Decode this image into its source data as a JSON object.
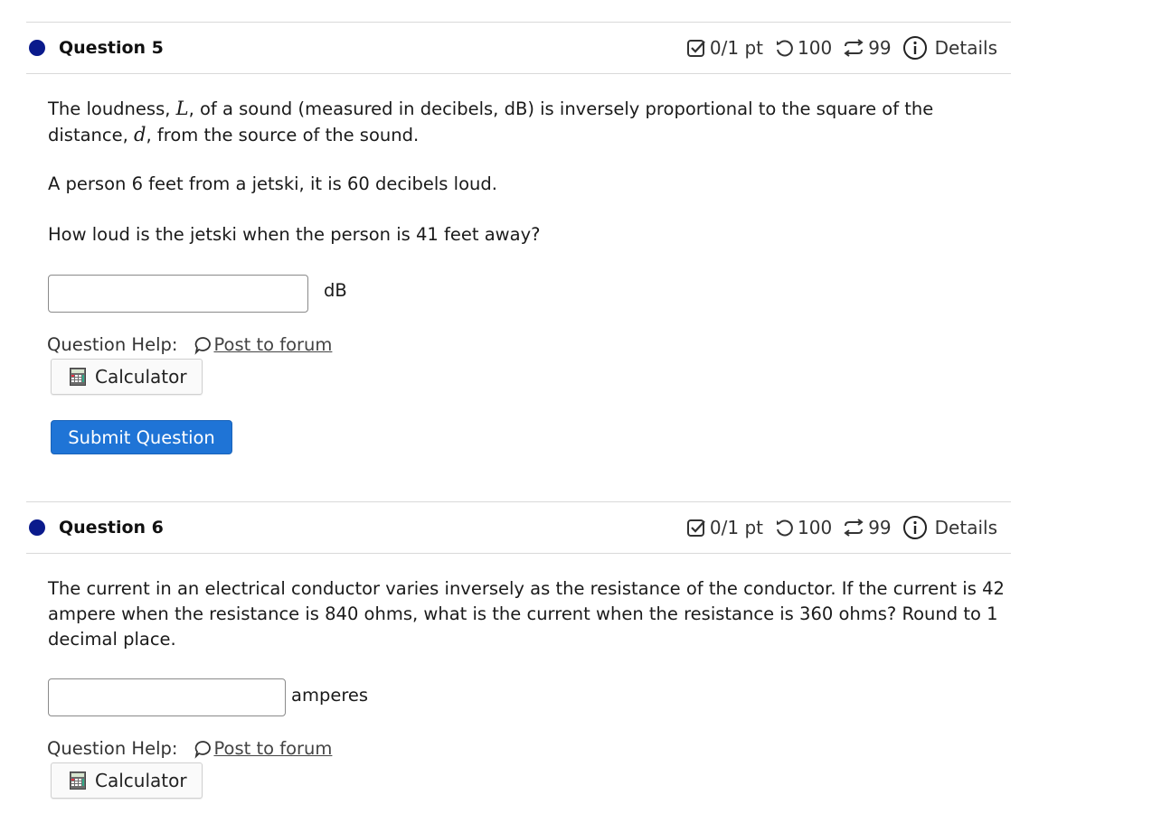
{
  "questions": [
    {
      "title": "Question 5",
      "meta": {
        "points": "0/1 pt",
        "tries": "100",
        "attempts": "99",
        "details": "Details"
      },
      "text_parts": {
        "p1_a": "The loudness, ",
        "p1_var1": "L",
        "p1_b": ", of a sound (measured in decibels, dB) is inversely proportional to the square of the distance, ",
        "p1_var2": "d",
        "p1_c": ", from the source of the sound.",
        "p2": "A person 6 feet from a jetski, it is 60 decibels loud.",
        "p3": "How loud is the jetski when the person is 41 feet away?"
      },
      "answer_value": "",
      "unit": "dB",
      "help_label": "Question Help:",
      "forum_link": "Post to forum",
      "calculator_label": "Calculator",
      "submit_label": "Submit Question"
    },
    {
      "title": "Question 6",
      "meta": {
        "points": "0/1 pt",
        "tries": "100",
        "attempts": "99",
        "details": "Details"
      },
      "text": "The current in an electrical conductor varies inversely as the resistance of the conductor. If the current is 42 ampere when the resistance is 840 ohms, what is the current when the resistance is 360 ohms? Round to 1 decimal place.",
      "answer_value": "",
      "unit": "amperes",
      "help_label": "Question Help:",
      "forum_link": "Post to forum",
      "calculator_label": "Calculator"
    }
  ],
  "colors": {
    "status_dot": "#0a1a8c",
    "submit_button": "#1f74d6"
  },
  "icons": [
    "checkbox-icon",
    "retry-icon",
    "attempts-icon",
    "info-icon",
    "chat-icon",
    "calculator-icon"
  ]
}
